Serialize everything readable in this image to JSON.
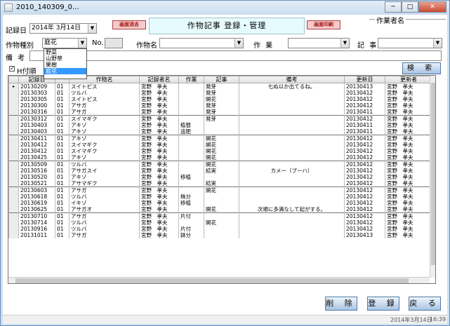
{
  "window": {
    "title": "2010_140309_0...",
    "buttons": [
      "─",
      "□",
      "✕"
    ]
  },
  "header": {
    "record_date_label": "記録日",
    "record_date_value": "2014年 3月14日",
    "left_pill": "画面消去",
    "title": "作物記事 登録・管理",
    "right_pill": "画面印刷",
    "author_label": "作業者名"
  },
  "filters": {
    "crop_type_label": "作物種別",
    "crop_type_value": "庭花",
    "no_label": "No.",
    "crop_name_label": "作物名",
    "work_label": "作 業",
    "article_label": "記 事",
    "memo_label": "備 考",
    "h_label": "H付順",
    "search_button": "検 索"
  },
  "dropdown": {
    "options": [
      "野菜",
      "山野草",
      "果樹",
      "庭花"
    ],
    "selected": 3
  },
  "grid": {
    "columns": [
      "",
      "記録日",
      "",
      "作物名",
      "記録者名",
      "作業",
      "記事",
      "備考",
      "更新日",
      "更新者"
    ],
    "rows": [
      [
        "▸",
        "20130209",
        "01",
        "スイトピス",
        "宮野　孝夫",
        "",
        "発芽",
        "七ぬ以か出てるね。",
        "20130413",
        "宮野　孝夫"
      ],
      [
        "",
        "20130303",
        "01",
        "ツルバ",
        "宮野　孝夫",
        "",
        "発芽",
        "",
        "20130412",
        "宮野　孝夫"
      ],
      [
        "",
        "20130305",
        "01",
        "スイトピス",
        "宮野　孝夫",
        "",
        "開花",
        "",
        "20130412",
        "宮野　孝夫"
      ],
      [
        "",
        "20130300",
        "01",
        "アサガ",
        "宮野　孝夫",
        "",
        "発芽",
        "",
        "20130412",
        "宮野　孝夫"
      ],
      [
        "",
        "20130316",
        "01",
        "アサガ",
        "宮野　孝夫",
        "",
        "発芽",
        "",
        "20130411",
        "宮野　孝夫"
      ],
      [
        "",
        "20130312",
        "01",
        "スイマギク",
        "宮野　孝夫",
        "",
        "発芽",
        "",
        "20130412",
        "宮野　孝夫"
      ],
      [
        "",
        "20130403",
        "01",
        "アキゾ",
        "宮野　孝夫",
        "植替",
        "",
        "",
        "20130411",
        "宮野　孝夫"
      ],
      [
        "",
        "20130403",
        "01",
        "アキゾ",
        "宮野　孝夫",
        "追肥",
        "",
        "",
        "20130411",
        "宮野　孝夫"
      ],
      [
        "",
        "20130411",
        "01",
        "アキゾ",
        "宮野　孝夫",
        "",
        "開花",
        "",
        "20130412",
        "宮野　孝夫"
      ],
      [
        "",
        "20130412",
        "01",
        "スイマギク",
        "宮野　孝夫",
        "",
        "開花",
        "",
        "20130412",
        "宮野　孝夫"
      ],
      [
        "",
        "20130412",
        "01",
        "スイマギク",
        "宮野　孝夫",
        "",
        "開花",
        "",
        "20130412",
        "宮野　孝夫"
      ],
      [
        "",
        "20130425",
        "01",
        "アキゾ",
        "宮野　孝夫",
        "",
        "開花",
        "",
        "20130412",
        "宮野　孝夫"
      ],
      [
        "",
        "20130509",
        "01",
        "ツルバ",
        "宮野　孝夫",
        "",
        "開花",
        "",
        "20130412",
        "宮野　孝夫"
      ],
      [
        "",
        "20130516",
        "01",
        "アサガスイ",
        "宮野　孝夫",
        "",
        "結実",
        "カメー（ブーハ）",
        "20130412",
        "宮野　孝夫"
      ],
      [
        "",
        "20130520",
        "01",
        "アキゾ",
        "宮野　孝夫",
        "移植",
        "",
        "",
        "20130412",
        "宮野　孝夫"
      ],
      [
        "",
        "20130521",
        "01",
        "アサマギク",
        "宮野　孝夫",
        "",
        "結実",
        "",
        "20130412",
        "宮野　孝夫"
      ],
      [
        "",
        "20130603",
        "01",
        "アサガ",
        "宮野　孝夫",
        "",
        "開花",
        "",
        "20130412",
        "宮野　孝夫"
      ],
      [
        "",
        "20130618",
        "01",
        "ツルバ",
        "宮野　孝夫",
        "株分",
        "",
        "",
        "20130412",
        "宮野　孝夫"
      ],
      [
        "",
        "20130619",
        "01",
        "イキゾ",
        "宮野　孝夫",
        "移植",
        "",
        "",
        "20130412",
        "宮野　孝夫"
      ],
      [
        "",
        "20130625",
        "01",
        "アサガオ",
        "宮野　孝夫",
        "",
        "開花",
        "次順に多満なして起がする。",
        "20130412",
        "宮野　孝夫"
      ],
      [
        "",
        "20130710",
        "01",
        "アサガ",
        "宮野　孝夫",
        "片付",
        "",
        "",
        "20130412",
        "宮野　孝夫"
      ],
      [
        "",
        "20130714",
        "01",
        "ツルバ",
        "宮野　孝夫",
        "",
        "開花",
        "",
        "20130412",
        "宮野　孝夫"
      ],
      [
        "",
        "20130916",
        "01",
        "ツルバ",
        "宮野　孝夫",
        "片付",
        "",
        "",
        "20130412",
        "宮野　孝夫"
      ],
      [
        "",
        "20131011",
        "01",
        "アサガ",
        "宮野　孝夫",
        "鉢分",
        "",
        "",
        "20130413",
        "宮野　孝夫"
      ]
    ]
  },
  "footer": {
    "delete_button": "削 除",
    "register_button": "登 録",
    "back_button": "戻 る"
  },
  "status": {
    "left": "2014年3月14日",
    "right": "16:39"
  }
}
